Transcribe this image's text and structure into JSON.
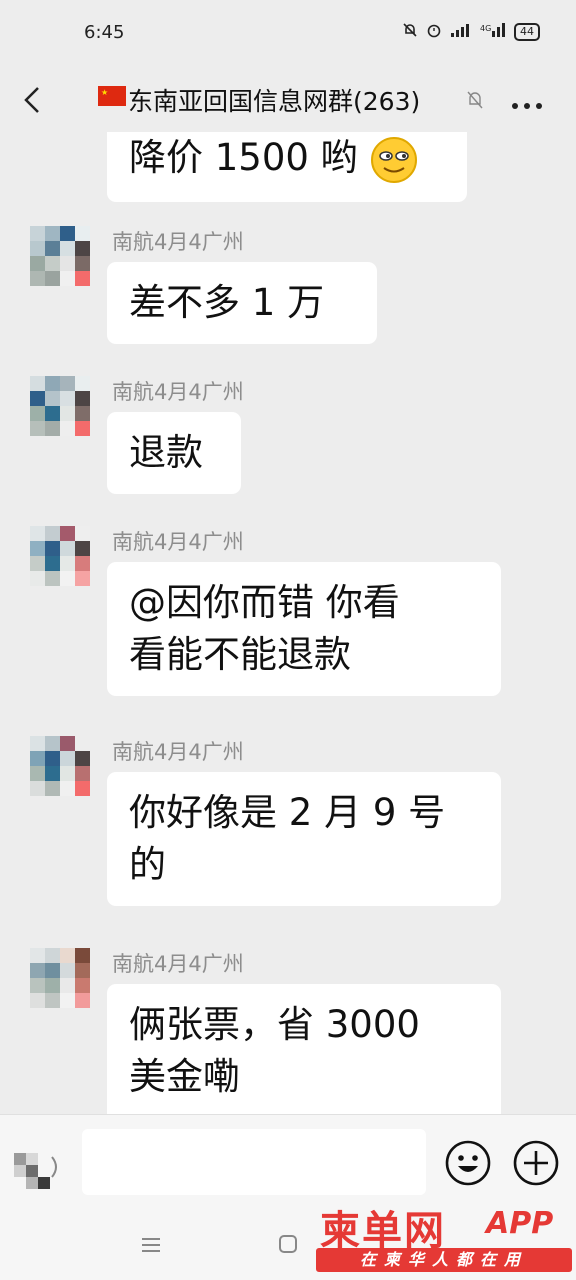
{
  "status": {
    "time": "6:45",
    "battery": "44"
  },
  "header": {
    "title": "东南亚回国信息网群(263)"
  },
  "messages": [
    {
      "sender": "",
      "text": "降价 1500 哟"
    },
    {
      "sender": "南航4月4广州",
      "text": "差不多 1 万"
    },
    {
      "sender": "南航4月4广州",
      "text": "退款"
    },
    {
      "sender": "南航4月4广州",
      "line1": "@因你而错  你看",
      "line2": "看能不能退款"
    },
    {
      "sender": "南航4月4广州",
      "line1": "你好像是 2 月 9 号",
      "line2": "的"
    },
    {
      "sender": "南航4月4广州",
      "line1": "俩张票，省 3000",
      "line2": "美金嘞"
    }
  ],
  "watermark": {
    "title": "柬单网",
    "app": "APP",
    "tagline": "在柬华人都在用"
  },
  "colors": {
    "background": "#ededed",
    "bubble": "#ffffff",
    "sender": "#8d8d8d",
    "watermark": "#e53935"
  }
}
